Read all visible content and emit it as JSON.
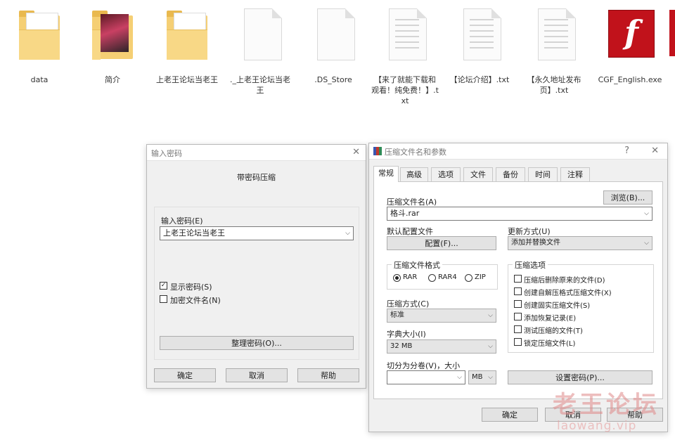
{
  "desktop": {
    "items": [
      {
        "label": "data",
        "kind": "folder"
      },
      {
        "label": "简介",
        "kind": "folder-photo"
      },
      {
        "label": "上老王论坛当老王",
        "kind": "folder"
      },
      {
        "label": "._上老王论坛当老王",
        "kind": "file"
      },
      {
        "label": ".DS_Store",
        "kind": "file"
      },
      {
        "label": "【来了就能下载和观看！纯免费！】.txt",
        "kind": "text"
      },
      {
        "label": "【论坛介绍】.txt",
        "kind": "text"
      },
      {
        "label": "【永久地址发布页】.txt",
        "kind": "text"
      },
      {
        "label": "CGF_English.exe",
        "kind": "flash"
      }
    ],
    "flash_glyph": "f"
  },
  "password_dialog": {
    "title": "输入密码",
    "close_glyph": "✕",
    "heading": "带密码压缩",
    "password_label": "输入密码(E)",
    "password_value": "上老王论坛当老王",
    "show_password_label": "显示密码(S)",
    "show_password_checked": true,
    "encrypt_names_label": "加密文件名(N)",
    "encrypt_names_checked": false,
    "organize_button": "整理密码(O)...",
    "ok_button": "确定",
    "cancel_button": "取消",
    "help_button": "帮助"
  },
  "archive_dialog": {
    "title": "压缩文件名和参数",
    "help_glyph": "?",
    "close_glyph": "✕",
    "tabs": [
      "常规",
      "高级",
      "选项",
      "文件",
      "备份",
      "时间",
      "注释"
    ],
    "active_tab": 0,
    "archive_name_label": "压缩文件名(A)",
    "browse_button": "浏览(B)...",
    "archive_name_value": "格斗.rar",
    "profile_label": "默认配置文件",
    "profile_button": "配置(F)...",
    "update_mode_label": "更新方式(U)",
    "update_mode_value": "添加并替换文件",
    "format_group": "压缩文件格式",
    "formats": [
      "RAR",
      "RAR4",
      "ZIP"
    ],
    "selected_format": 0,
    "method_label": "压缩方式(C)",
    "method_value": "标准",
    "dict_label": "字典大小(I)",
    "dict_value": "32 MB",
    "split_label": "切分为分卷(V)，大小",
    "split_value": "",
    "split_unit": "MB",
    "options_group": "压缩选项",
    "options": [
      {
        "label": "压缩后删除原来的文件(D)",
        "checked": false
      },
      {
        "label": "创建自解压格式压缩文件(X)",
        "checked": false
      },
      {
        "label": "创建固实压缩文件(S)",
        "checked": false
      },
      {
        "label": "添加恢复记录(E)",
        "checked": false
      },
      {
        "label": "测试压缩的文件(T)",
        "checked": false
      },
      {
        "label": "锁定压缩文件(L)",
        "checked": false
      }
    ],
    "set_password_button": "设置密码(P)...",
    "ok_button": "确定",
    "cancel_button": "取消",
    "help_button": "帮助"
  },
  "watermark": {
    "text": "老王论坛",
    "url": "laowang.vip"
  },
  "colors": {
    "flash_red": "#c1121b",
    "folder_yellow": "#f5cf74",
    "watermark": "#e08a8a"
  }
}
